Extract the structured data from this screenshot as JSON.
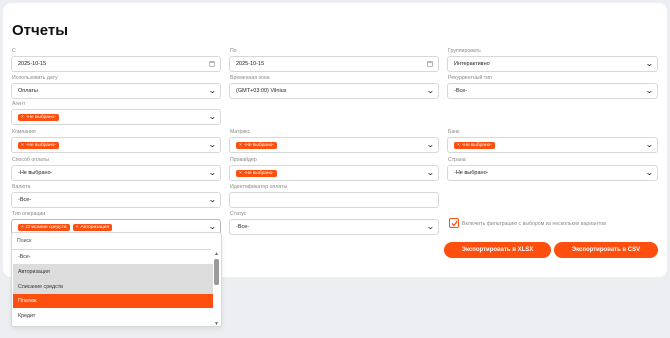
{
  "page": {
    "title": "Отчеты"
  },
  "filters": {
    "from": {
      "label": "С",
      "value": "2025-10-15"
    },
    "to": {
      "label": "По",
      "value": "2025-10-15"
    },
    "group": {
      "label": "Группировать",
      "value": "Интерактивно"
    },
    "date_use": {
      "label": "Использовать дату",
      "value": "Оплаты"
    },
    "timezone": {
      "label": "Временная зона",
      "value": "(GMT+03:00) Vilnius"
    },
    "recurring": {
      "label": "Рекуррентный тип",
      "value": "-Все-"
    },
    "agent": {
      "label": "Агент",
      "tag": "-Не выбрано-"
    },
    "company": {
      "label": "Компания",
      "tag": "-Не выбрано-"
    },
    "matrix": {
      "label": "Матрикс",
      "tag": "-Не выбрано-"
    },
    "bank": {
      "label": "Банк",
      "tag": "-Не выбрано-"
    },
    "payment_method": {
      "label": "Способ оплаты",
      "value": "-Не выбрано-"
    },
    "provider": {
      "label": "Провайдер",
      "tag": "-Не выбрано-"
    },
    "country": {
      "label": "Страна",
      "value": "-Не выбрано-"
    },
    "currency": {
      "label": "Валюта",
      "value": "-Все-"
    },
    "payment_id": {
      "label": "Идентификатор оплаты",
      "value": ""
    },
    "operation_type": {
      "label": "Тип операции",
      "tags": [
        "Списание средств",
        "Авторизация"
      ]
    },
    "status": {
      "label": "Статус",
      "value": "-Все-"
    },
    "multi_filter": {
      "label": "Включить фильтрацию с выбором из нескольких вариантов",
      "checked": true
    }
  },
  "buttons": {
    "export_xlsx": "Экспортировать в XLSX",
    "export_csv": "Экспортировать в CSV"
  },
  "dropdown": {
    "search_placeholder": "Поиск",
    "options": [
      "-Все-",
      "Авторизация",
      "Списание средств",
      "Платеж",
      "Кредит"
    ],
    "selected": [
      "Авторизация",
      "Списание средств"
    ],
    "highlighted": "Платеж"
  },
  "colors": {
    "accent": "#ff4f0f",
    "background": "#eceef1"
  }
}
